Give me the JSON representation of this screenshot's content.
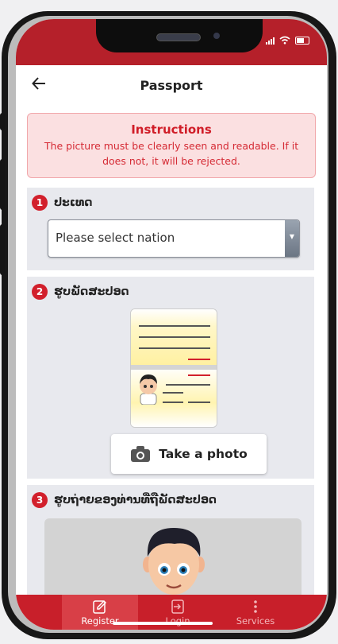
{
  "header": {
    "title": "Passport",
    "back_icon": "arrow-left-icon"
  },
  "instructions": {
    "title": "Instructions",
    "text": "The picture must be clearly seen and readable. If it does not, it will be rejected."
  },
  "sections": [
    {
      "number": "1",
      "label": "ປະເທດ",
      "select_value": "Please select nation"
    },
    {
      "number": "2",
      "label": "ຮູບພັດສະປອດ",
      "button_label": "Take a photo"
    },
    {
      "number": "3",
      "label": "ຮູບຖ່າຍຂອງທ່ານທີ່ຖືພັດສະປອດ"
    }
  ],
  "tabs": [
    {
      "label": "Register",
      "icon": "edit-icon",
      "active": true
    },
    {
      "label": "Login",
      "icon": "login-icon",
      "active": false
    },
    {
      "label": "Services",
      "icon": "more-vertical-icon",
      "active": false
    }
  ],
  "colors": {
    "accent": "#c81f2a",
    "instruction_bg": "#fbe0e1",
    "section_bg": "#e8e9ee"
  }
}
